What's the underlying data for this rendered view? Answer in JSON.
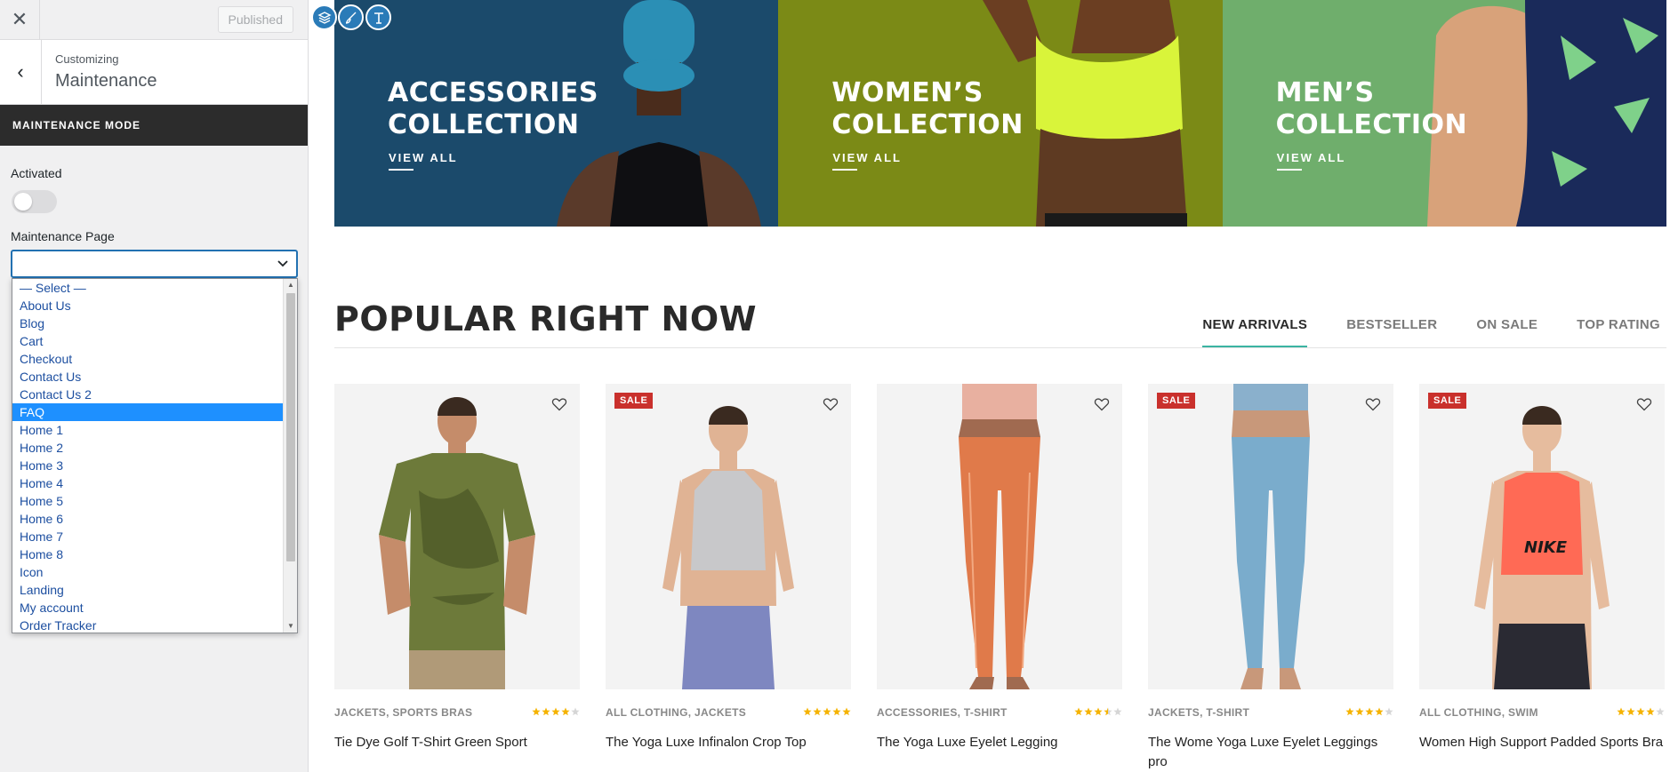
{
  "customizer": {
    "close_icon": "close-icon",
    "publish_label": "Published",
    "customizing_label": "Customizing",
    "section_title": "Maintenance",
    "panel_header": "MAINTENANCE MODE",
    "activated_label": "Activated",
    "activated_on": false,
    "page_label": "Maintenance Page",
    "page_value": "",
    "options": [
      "— Select —",
      "About Us",
      "Blog",
      "Cart",
      "Checkout",
      "Contact Us",
      "Contact Us 2",
      "FAQ",
      "Home 1",
      "Home 2",
      "Home 3",
      "Home 4",
      "Home 5",
      "Home 6",
      "Home 7",
      "Home 8",
      "Icon",
      "Landing",
      "My account",
      "Order Tracker"
    ],
    "highlighted_option": "FAQ"
  },
  "editor_icons": [
    "layers-icon",
    "brush-icon",
    "text-icon"
  ],
  "banners": [
    {
      "title": "ACCESSORIES\nCOLLECTION",
      "link": "VIEW ALL",
      "bg": "#1b4a6b"
    },
    {
      "title": "WOMEN’S\nCOLLECTION",
      "link": "VIEW ALL",
      "bg": "#7b8a16"
    },
    {
      "title": "MEN’S\nCOLLECTION",
      "link": "VIEW ALL",
      "bg": "#6fae6c"
    }
  ],
  "popular": {
    "title": "POPULAR RIGHT NOW",
    "tabs": [
      "NEW ARRIVALS",
      "BESTSELLER",
      "ON SALE",
      "TOP RATING"
    ],
    "active_tab": "NEW ARRIVALS"
  },
  "products": [
    {
      "cats": "JACKETS, SPORTS BRAS",
      "title": "Tie Dye Golf T-Shirt Green Sport",
      "sale": "",
      "rating": 4,
      "garment": "tshirt"
    },
    {
      "cats": "ALL CLOTHING, JACKETS",
      "title": "The Yoga Luxe Infinalon Crop Top",
      "sale": "SALE",
      "rating": 5,
      "garment": "croptop"
    },
    {
      "cats": "ACCESSORIES, T-SHIRT",
      "title": "The Yoga Luxe Eyelet Legging",
      "sale": "",
      "rating": 3.5,
      "garment": "legging-orange"
    },
    {
      "cats": "JACKETS, T-SHIRT",
      "title": "The Wome Yoga Luxe Eyelet Leggings pro",
      "sale": "SALE",
      "rating": 4,
      "garment": "legging-blue"
    },
    {
      "cats": "ALL CLOTHING, SWIM",
      "title": "Women High Support Padded Sports Bra",
      "sale": "SALE",
      "rating": 4,
      "garment": "sportsbra"
    }
  ],
  "colors": {
    "accent": "#3bb4a2",
    "sale": "#c9302c",
    "star": "#f5b301",
    "select_border": "#2271b1",
    "highlight": "#1e90ff"
  }
}
